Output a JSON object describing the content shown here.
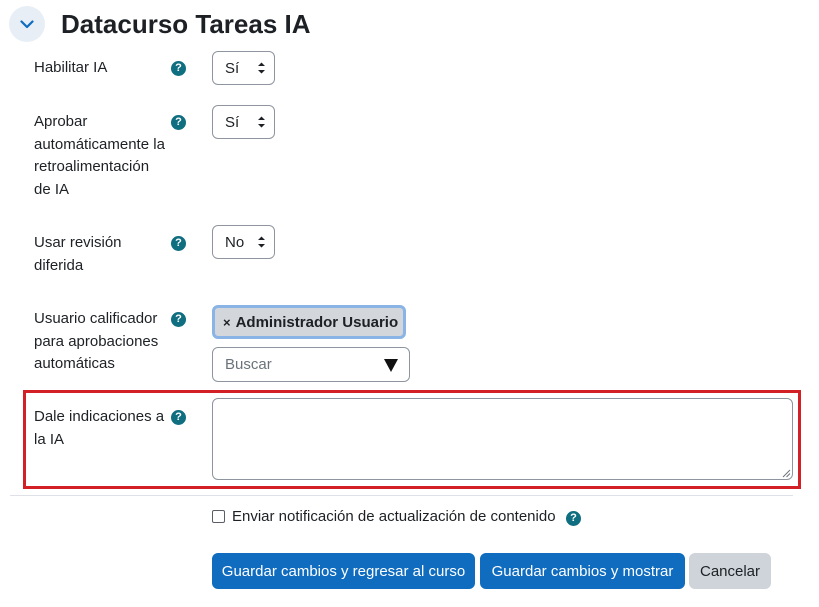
{
  "section": {
    "title": "Datacurso Tareas IA"
  },
  "fields": {
    "enable_ai": {
      "label": "Habilitar IA",
      "value": "Sí"
    },
    "auto_approve": {
      "label_lines": [
        "Aprobar",
        "automáticamente la",
        "retroalimentación",
        "de IA"
      ],
      "value": "Sí"
    },
    "deferred_review": {
      "label_lines": [
        "Usar revisión",
        "diferida"
      ],
      "value": "No"
    },
    "grader_user": {
      "label_lines": [
        "Usuario calificador",
        "para aprobaciones",
        "automáticas"
      ],
      "selected_chip": "Administrador Usuario",
      "chip_remove": "×",
      "search_placeholder": "Buscar"
    },
    "ai_instructions": {
      "label_lines": [
        "Dale indicaciones a",
        "la IA"
      ],
      "value": ""
    }
  },
  "help_glyph": "?",
  "notify": {
    "label": "Enviar notificación de actualización de contenido",
    "checked": false
  },
  "buttons": {
    "save_return": "Guardar cambios y regresar al curso",
    "save_display": "Guardar cambios y mostrar",
    "cancel": "Cancelar"
  },
  "colors": {
    "primary": "#0f6cbf",
    "help_icon": "#0f6e80",
    "highlight_border": "#d32027",
    "chip_bg": "#d3d6da"
  }
}
